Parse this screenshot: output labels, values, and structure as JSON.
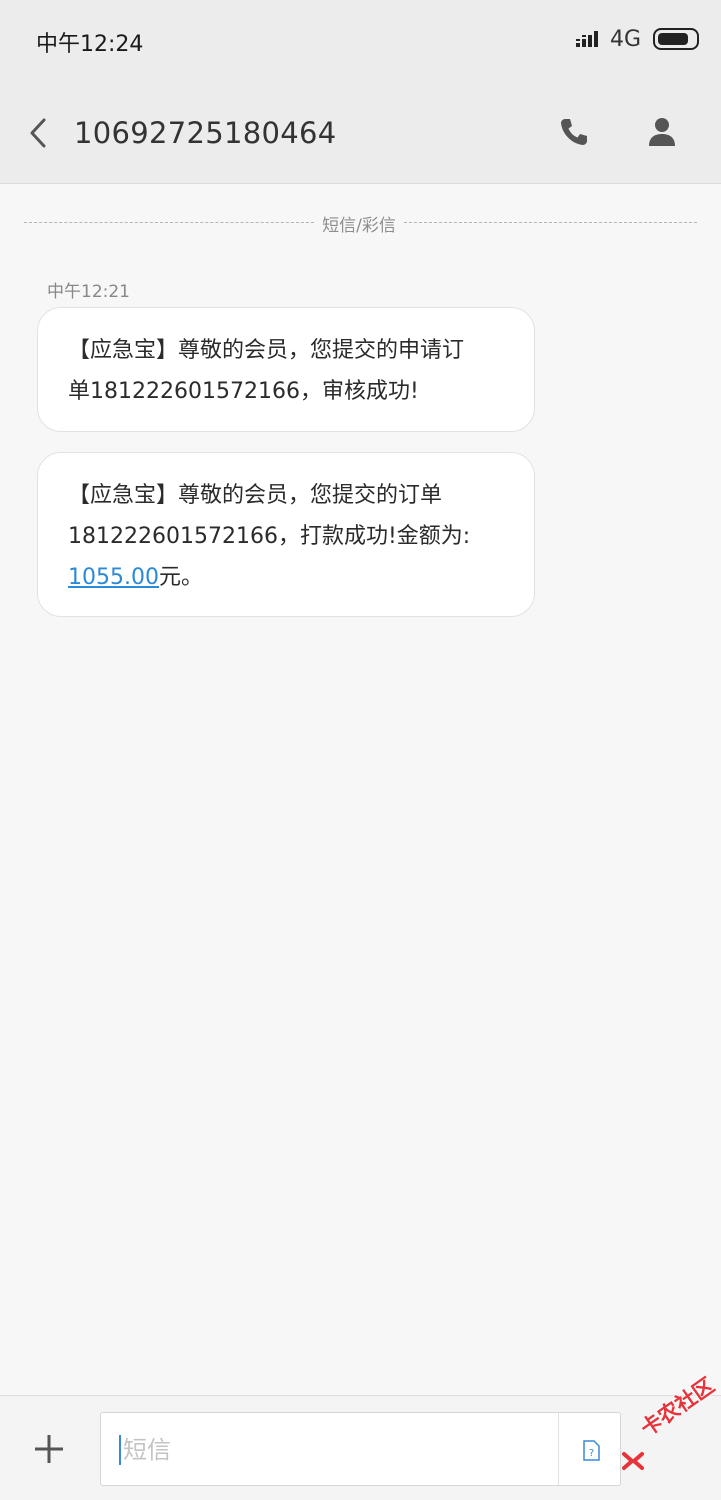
{
  "status_bar": {
    "time": "中午12:24",
    "network": "4G",
    "signal_icon": "signal-bars-icon",
    "battery_icon": "battery-icon"
  },
  "app_bar": {
    "title": "10692725180464",
    "back_icon": "chevron-left-icon",
    "call_icon": "phone-icon",
    "contact_icon": "person-icon"
  },
  "conversation": {
    "channel_label": "短信/彩信",
    "timestamp": "中午12:21",
    "messages": [
      {
        "lines": [
          "【应急宝】尊敬的会员，您提交的申请订",
          "单181222601572166，审核成功!"
        ]
      },
      {
        "lines": [
          "【应急宝】尊敬的会员，您提交的订单",
          "181222601572166，打款成功!金额为:"
        ],
        "amount": "1055.00",
        "amount_suffix": "元。"
      }
    ]
  },
  "composer": {
    "placeholder": "短信",
    "add_icon": "plus-icon",
    "sim_icon": "sim-card-icon"
  },
  "watermark": {
    "text": "卡农社区"
  },
  "colors": {
    "background": "#f7f7f7",
    "header": "#ececec",
    "bubble": "#ffffff",
    "link": "#2a8ad8",
    "watermark": "#e8333a"
  }
}
